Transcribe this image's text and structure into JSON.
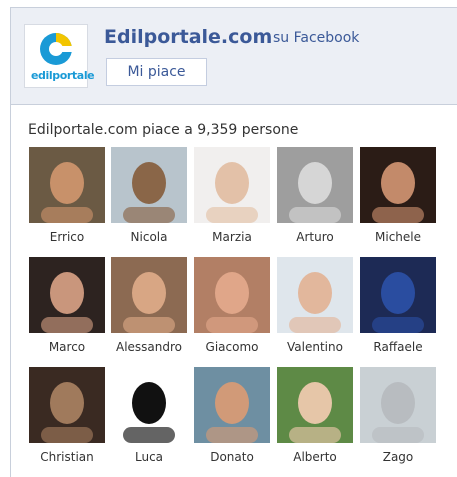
{
  "header": {
    "page_name": "Edilportale.com",
    "suffix": "su Facebook",
    "logo_text": "edilportale",
    "like_button": "Mi piace"
  },
  "fans": {
    "summary": "Edilportale.com piace a 9,359 persone",
    "people": [
      {
        "name": "Errico",
        "bg": "#6b5a44",
        "skin": "#c8916a"
      },
      {
        "name": "Nicola",
        "bg": "#b8c4cc",
        "skin": "#8a6648"
      },
      {
        "name": "Marzia",
        "bg": "#f1efee",
        "skin": "#e3c1a8"
      },
      {
        "name": "Arturo",
        "bg": "#9e9e9e",
        "skin": "#d6d6d6"
      },
      {
        "name": "Michele",
        "bg": "#2b1c16",
        "skin": "#c38a6a"
      },
      {
        "name": "Marco",
        "bg": "#2d2320",
        "skin": "#c9967c"
      },
      {
        "name": "Alessandro",
        "bg": "#8c6a52",
        "skin": "#d8a684"
      },
      {
        "name": "Giacomo",
        "bg": "#b27f65",
        "skin": "#e0a689"
      },
      {
        "name": "Valentino",
        "bg": "#dfe6ec",
        "skin": "#e2b79c"
      },
      {
        "name": "Raffaele",
        "bg": "#1d2a55",
        "skin": "#2a4da0"
      },
      {
        "name": "Christian",
        "bg": "#3a2a22",
        "skin": "#a07a5c"
      },
      {
        "name": "Luca",
        "bg": "#ffffff",
        "skin": "#111111"
      },
      {
        "name": "Donato",
        "bg": "#6e8fa2",
        "skin": "#d19a78"
      },
      {
        "name": "Alberto",
        "bg": "#5e8a46",
        "skin": "#e6c6a8"
      },
      {
        "name": "Zago",
        "bg": "#c9d0d4",
        "skin": "#b8bcc0"
      }
    ]
  }
}
